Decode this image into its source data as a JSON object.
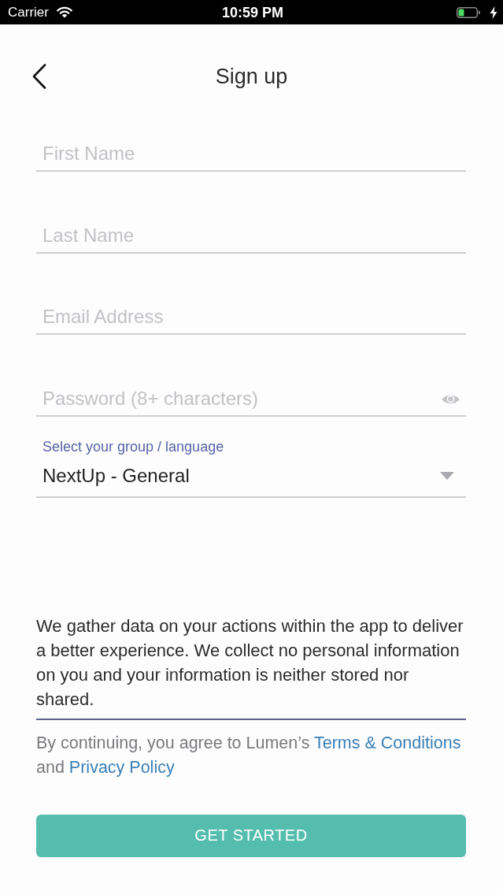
{
  "status_bar": {
    "carrier": "Carrier",
    "time": "10:59 PM"
  },
  "header": {
    "title": "Sign up"
  },
  "fields": [
    {
      "kind": "text",
      "placeholder": "First Name"
    },
    {
      "kind": "text",
      "placeholder": "Last Name"
    },
    {
      "kind": "text",
      "placeholder": "Email Address"
    },
    {
      "kind": "password",
      "placeholder": "Password (8+ characters)"
    }
  ],
  "group_select": {
    "label": "Select your group / language",
    "value": "NextUp - General"
  },
  "privacy_notice": "We gather data on your actions within the app to deliver a better experience. We collect no personal information on you and your information is neither stored nor shared.",
  "consent": [
    {
      "kind": "text",
      "text": "By continuing, you agree to Lumen’s "
    },
    {
      "kind": "link",
      "text": "Terms & Conditions"
    },
    {
      "kind": "text",
      "text": " and "
    },
    {
      "kind": "link",
      "text": "Privacy Policy"
    }
  ],
  "primary_button": {
    "label": "GET STARTED"
  }
}
